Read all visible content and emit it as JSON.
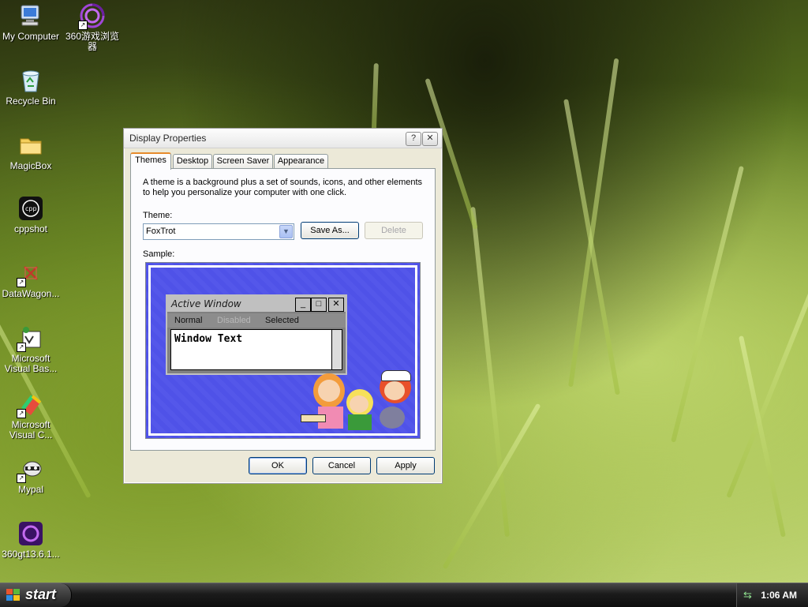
{
  "desktop": {
    "icons": [
      {
        "label": "My Computer",
        "icon": "my-computer-icon"
      },
      {
        "label": "360游戏浏览器",
        "icon": "360-browser-icon"
      },
      {
        "label": "Recycle Bin",
        "icon": "recycle-bin-icon"
      },
      {
        "label": "MagicBox",
        "icon": "folder-icon"
      },
      {
        "label": "cppshot",
        "icon": "cppshot-icon"
      },
      {
        "label": "DataWagon...",
        "icon": "datawagon-icon"
      },
      {
        "label": "Microsoft Visual Bas...",
        "icon": "visual-basic-icon"
      },
      {
        "label": "Microsoft Visual C...",
        "icon": "visual-c-icon"
      },
      {
        "label": "Mypal",
        "icon": "mypal-icon"
      },
      {
        "label": "360gt13.6.1...",
        "icon": "360gt-icon"
      }
    ]
  },
  "dialog": {
    "title": "Display Properties",
    "help_btn": "?",
    "close_btn": "✕",
    "tabs": [
      "Themes",
      "Desktop",
      "Screen Saver",
      "Appearance"
    ],
    "active_tab": "Themes",
    "description": "A theme is a background plus a set of sounds, icons, and other elements to help you personalize your computer with one click.",
    "theme_label": "Theme:",
    "theme_value": "FoxTrot",
    "save_as": "Save As...",
    "delete": "Delete",
    "sample_label": "Sample:",
    "sample": {
      "window_title": "Active Window",
      "menu_normal": "Normal",
      "menu_disabled": "Disabled",
      "menu_selected": "Selected",
      "window_text": "Window Text",
      "min_btn": "_",
      "max_btn": "□",
      "close_btn": "✕"
    },
    "ok": "OK",
    "cancel": "Cancel",
    "apply": "Apply"
  },
  "taskbar": {
    "start_label": "start",
    "clock": "1:06 AM"
  },
  "colors": {
    "sample_bg": "#5053e9",
    "accent_tab": "#e68b2c"
  }
}
